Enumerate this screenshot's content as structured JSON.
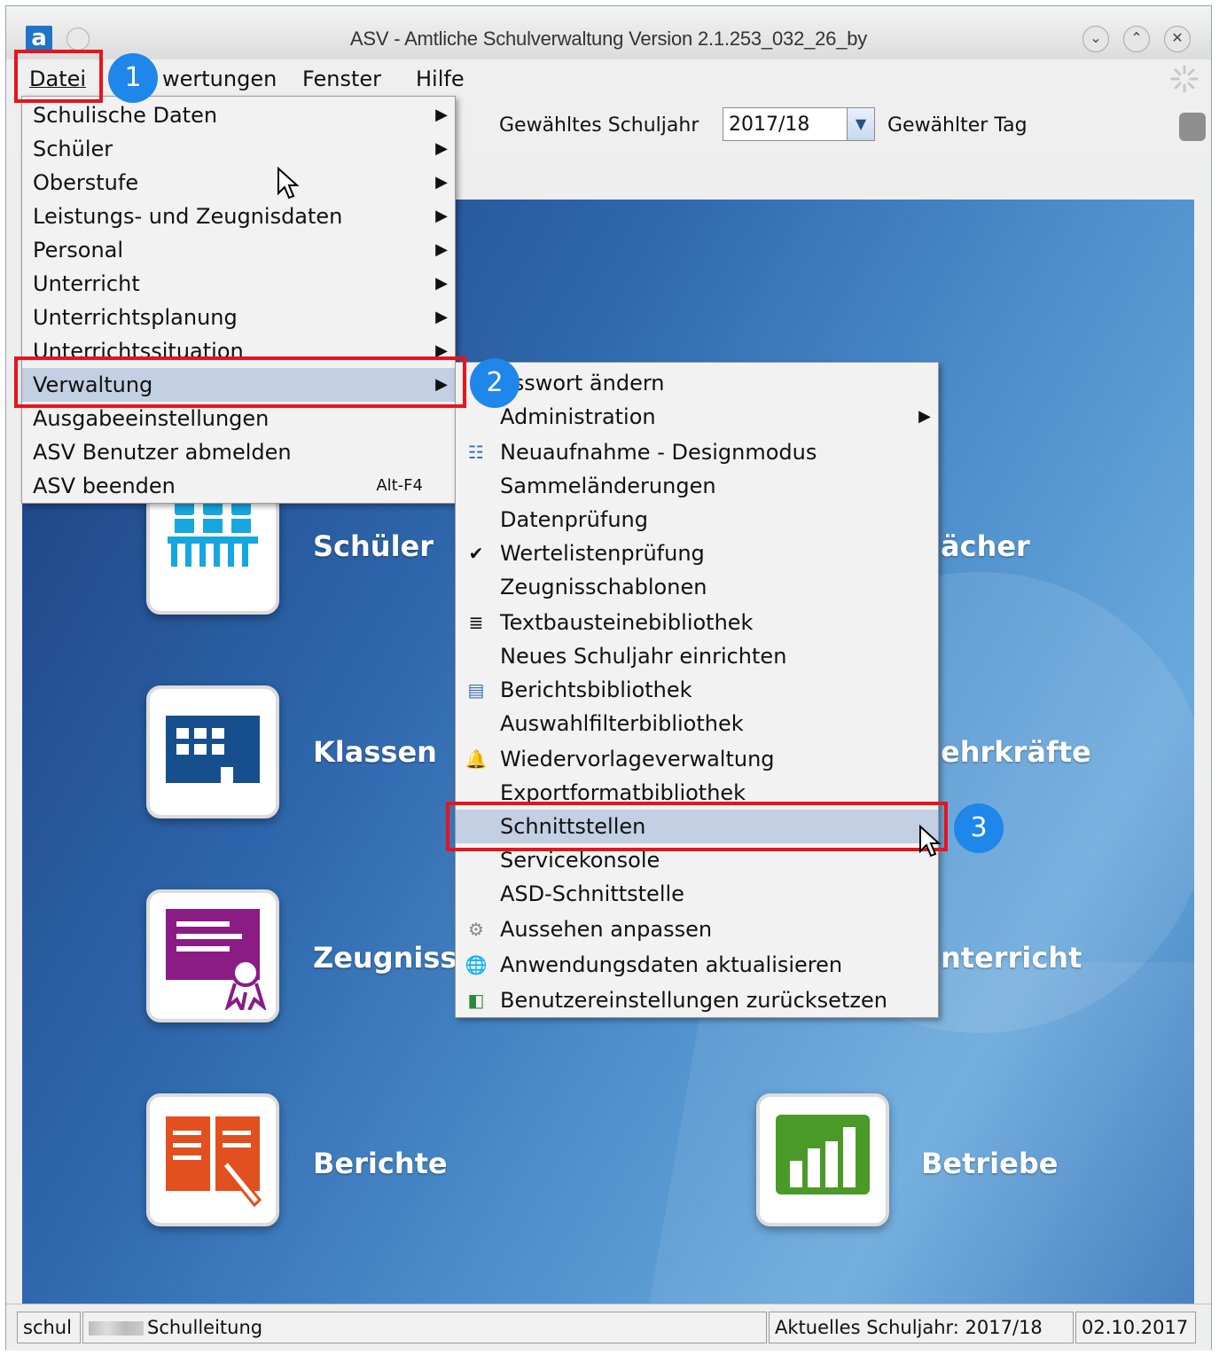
{
  "window": {
    "title": "ASV - Amtliche Schulverwaltung Version 2.1.253_032_26_by",
    "logo_letter": "a"
  },
  "menubar": {
    "datei": "Datei",
    "auswertungen": "wertungen",
    "fenster": "Fenster",
    "hilfe": "Hilfe"
  },
  "toolbar": {
    "schuljahr_label": "Gewähltes Schuljahr",
    "schuljahr_value": "2017/18",
    "tag_label": "Gewählter Tag"
  },
  "datei_menu": [
    {
      "label": "Schulische Daten",
      "submenu": true
    },
    {
      "label": "Schüler",
      "submenu": true
    },
    {
      "label": "Oberstufe",
      "submenu": true
    },
    {
      "label": "Leistungs- und Zeugnisdaten",
      "submenu": true
    },
    {
      "label": "Personal",
      "submenu": true
    },
    {
      "label": "Unterricht",
      "submenu": true
    },
    {
      "label": "Unterrichtsplanung",
      "submenu": true
    },
    {
      "label": "Unterrichtssituation",
      "submenu": true
    },
    {
      "label": "Verwaltung",
      "submenu": true,
      "selected": true
    },
    {
      "label": "Ausgabeeinstellungen"
    },
    {
      "label": "ASV Benutzer abmelden"
    },
    {
      "label": "ASV beenden",
      "accel": "Alt-F4"
    }
  ],
  "verwaltung_menu": [
    {
      "label": "asswort ändern"
    },
    {
      "label": "Administration",
      "submenu": true
    },
    {
      "label": "Neuaufnahme - Designmodus",
      "icon": "form-icon"
    },
    {
      "label": "Sammeländerungen"
    },
    {
      "label": "Datenprüfung"
    },
    {
      "label": "Wertelistenprüfung",
      "icon": "checkmark-icon"
    },
    {
      "label": "Zeugnisschablonen"
    },
    {
      "label": "Textbausteinebibliothek",
      "icon": "text-block-icon"
    },
    {
      "label": "Neues Schuljahr einrichten"
    },
    {
      "label": "Berichtsbibliothek",
      "icon": "report-library-icon"
    },
    {
      "label": "Auswahlfilterbibliothek"
    },
    {
      "label": "Wiedervorlageverwaltung",
      "icon": "bell-icon"
    },
    {
      "label": "Exportformatbibliothek"
    },
    {
      "label": "Schnittstellen",
      "selected": true
    },
    {
      "label": "Servicekonsole"
    },
    {
      "label": "ASD-Schnittstelle"
    },
    {
      "label": "Aussehen anpassen",
      "icon": "gear-icon"
    },
    {
      "label": "Anwendungsdaten aktualisieren",
      "icon": "globe-icon"
    },
    {
      "label": "Benutzereinstellungen zurücksetzen",
      "icon": "reset-icon"
    }
  ],
  "tiles": {
    "schueler": "Schüler",
    "faecher": "ächer",
    "klassen": "Klassen",
    "lehrkraefte": "ehrkräfte",
    "zeugnisse": "Zeugnisse",
    "unterricht": "nterricht",
    "berichte": "Berichte",
    "betriebe": "Betriebe"
  },
  "statusbar": {
    "user": "schul",
    "role": "Schulleitung",
    "current_year": "Aktuelles Schuljahr: 2017/18",
    "date": "02.10.2017"
  },
  "annotations": {
    "badge1": "1",
    "badge2": "2",
    "badge3": "3"
  },
  "colors": {
    "highlight": "#e8141b",
    "badge": "#1f86ea",
    "menu_selection": "#c3cfe2"
  }
}
